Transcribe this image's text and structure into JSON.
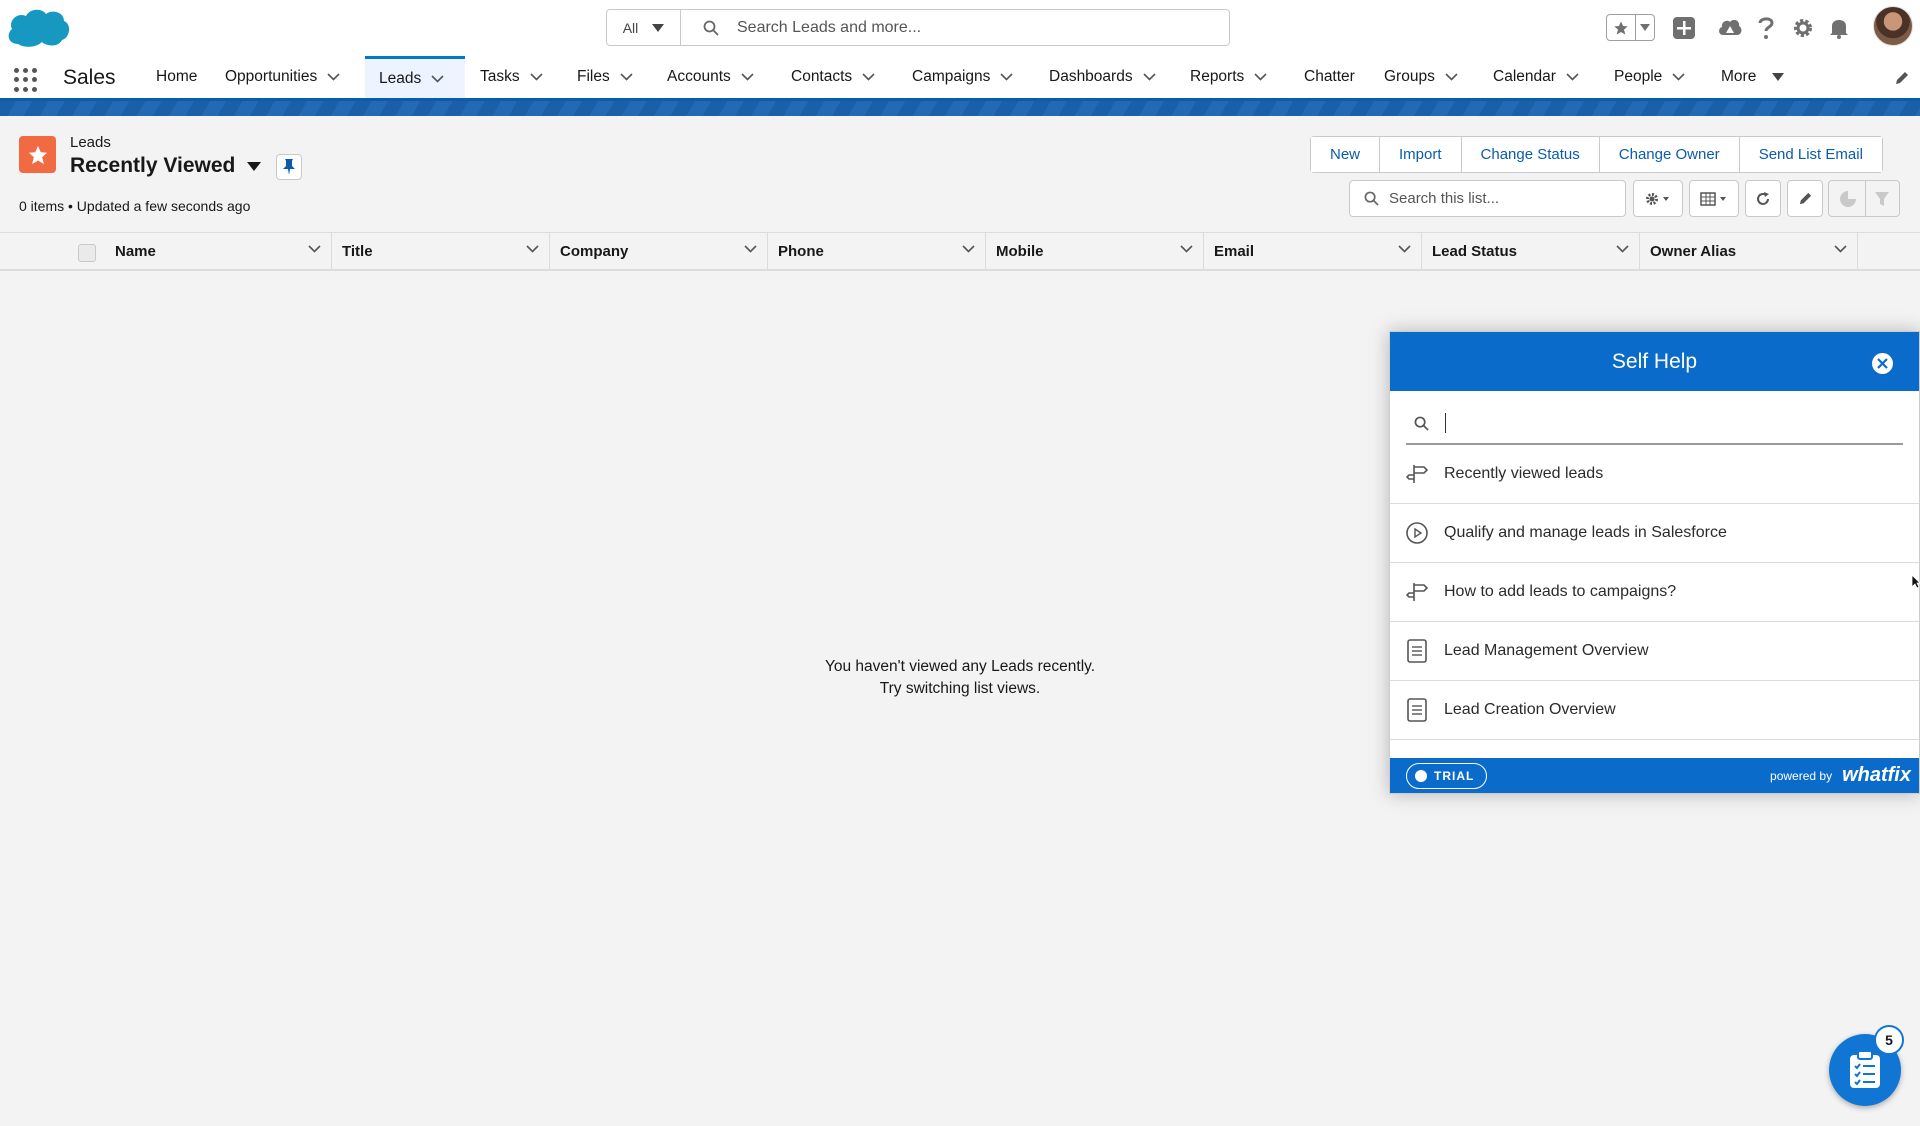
{
  "header": {
    "search_scope": "All",
    "search_placeholder": "Search Leads and more..."
  },
  "nav": {
    "app_name": "Sales",
    "items": [
      {
        "label": "Home"
      },
      {
        "label": "Opportunities"
      },
      {
        "label": "Leads"
      },
      {
        "label": "Tasks"
      },
      {
        "label": "Files"
      },
      {
        "label": "Accounts"
      },
      {
        "label": "Contacts"
      },
      {
        "label": "Campaigns"
      },
      {
        "label": "Dashboards"
      },
      {
        "label": "Reports"
      },
      {
        "label": "Chatter"
      },
      {
        "label": "Groups"
      },
      {
        "label": "Calendar"
      },
      {
        "label": "People"
      },
      {
        "label": "More"
      }
    ],
    "active": "Leads"
  },
  "list": {
    "object_name": "Leads",
    "view_name": "Recently Viewed",
    "meta": "0 items • Updated a few seconds ago",
    "actions": [
      "New",
      "Import",
      "Change Status",
      "Change Owner",
      "Send List Email"
    ],
    "search_placeholder": "Search this list...",
    "columns": [
      "Name",
      "Title",
      "Company",
      "Phone",
      "Mobile",
      "Email",
      "Lead Status",
      "Owner Alias"
    ],
    "empty_line1": "You haven't viewed any Leads recently.",
    "empty_line2": "Try switching list views."
  },
  "selfhelp": {
    "title": "Self Help",
    "search_value": "",
    "items": [
      {
        "label": "Recently viewed leads",
        "icon": "signpost-icon"
      },
      {
        "label": "Qualify and manage leads in Salesforce",
        "icon": "play-circle-icon"
      },
      {
        "label": "How to add leads to campaigns?",
        "icon": "signpost-icon"
      },
      {
        "label": "Lead Management Overview",
        "icon": "document-icon"
      },
      {
        "label": "Lead Creation Overview",
        "icon": "document-icon"
      }
    ],
    "trial_label": "TRIAL",
    "powered_by": "powered by",
    "brand": "whatfix"
  },
  "fab": {
    "badge_count": "5"
  },
  "colors": {
    "brand_blue": "#0b5cab",
    "selfhelp_blue": "#0b6bcb",
    "lead_icon": "#f26a42"
  }
}
